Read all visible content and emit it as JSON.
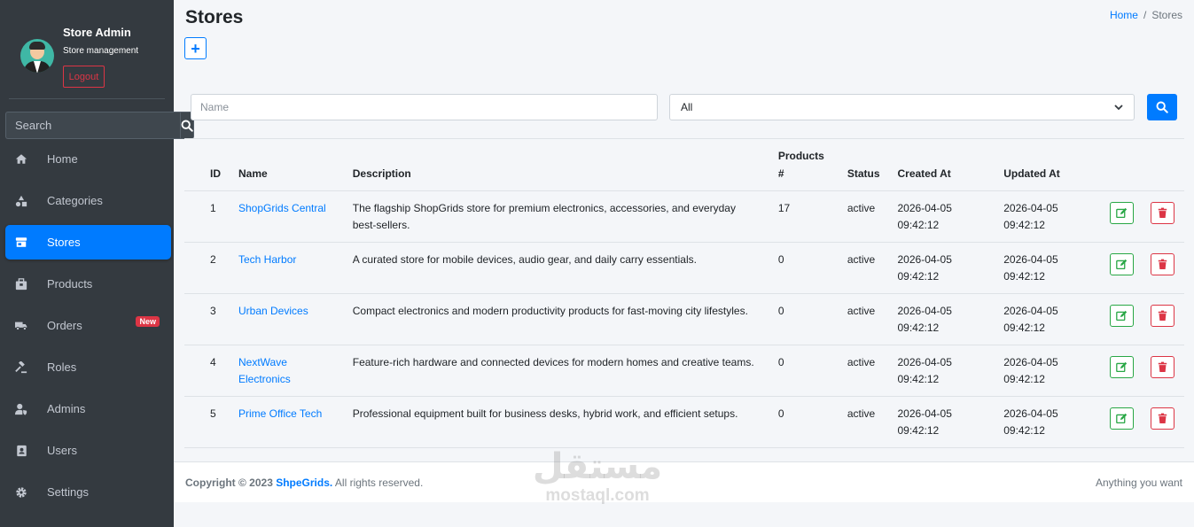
{
  "sidebar": {
    "user_name": "Store Admin",
    "user_role": "Store management",
    "logout_label": "Logout",
    "search_placeholder": "Search",
    "nav": [
      {
        "label": "Home",
        "icon": "home-icon"
      },
      {
        "label": "Categories",
        "icon": "shapes-icon"
      },
      {
        "label": "Stores",
        "icon": "store-icon",
        "active": true
      },
      {
        "label": "Products",
        "icon": "box-icon"
      },
      {
        "label": "Orders",
        "icon": "truck-icon",
        "badge": "New"
      },
      {
        "label": "Roles",
        "icon": "gavel-icon"
      },
      {
        "label": "Admins",
        "icon": "user-shield-icon"
      },
      {
        "label": "Users",
        "icon": "id-card-icon"
      },
      {
        "label": "Settings",
        "icon": "gear-icon"
      }
    ]
  },
  "header": {
    "title": "Stores",
    "breadcrumb_home": "Home",
    "breadcrumb_sep": "/",
    "breadcrumb_current": "Stores",
    "add_label": "+"
  },
  "filters": {
    "name_placeholder": "Name",
    "status_selected": "All"
  },
  "table": {
    "headers": {
      "id": "ID",
      "name": "Name",
      "description": "Description",
      "products_line1": "Products",
      "products_line2": "#",
      "status": "Status",
      "created": "Created At",
      "updated": "Updated At"
    },
    "rows": [
      {
        "id": "1",
        "name": "ShopGrids Central",
        "description": "The flagship ShopGrids store for premium electronics, accessories, and everyday best-sellers.",
        "products": "17",
        "status": "active",
        "created_date": "2026-04-05",
        "created_time": "09:42:12",
        "updated_date": "2026-04-05",
        "updated_time": "09:42:12"
      },
      {
        "id": "2",
        "name": "Tech Harbor",
        "description": "A curated store for mobile devices, audio gear, and daily carry essentials.",
        "products": "0",
        "status": "active",
        "created_date": "2026-04-05",
        "created_time": "09:42:12",
        "updated_date": "2026-04-05",
        "updated_time": "09:42:12"
      },
      {
        "id": "3",
        "name": "Urban Devices",
        "description": "Compact electronics and modern productivity products for fast-moving city lifestyles.",
        "products": "0",
        "status": "active",
        "created_date": "2026-04-05",
        "created_time": "09:42:12",
        "updated_date": "2026-04-05",
        "updated_time": "09:42:12"
      },
      {
        "id": "4",
        "name": "NextWave Electronics",
        "description": "Feature-rich hardware and connected devices for modern homes and creative teams.",
        "products": "0",
        "status": "active",
        "created_date": "2026-04-05",
        "created_time": "09:42:12",
        "updated_date": "2026-04-05",
        "updated_time": "09:42:12"
      },
      {
        "id": "5",
        "name": "Prime Office Tech",
        "description": "Professional equipment built for business desks, hybrid work, and efficient setups.",
        "products": "0",
        "status": "active",
        "created_date": "2026-04-05",
        "created_time": "09:42:12",
        "updated_date": "2026-04-05",
        "updated_time": "09:42:12"
      }
    ]
  },
  "footer": {
    "copyright": "Copyright © 2023",
    "brand": "ShpeGrids.",
    "rights": "All rights reserved.",
    "tagline": "Anything you want"
  },
  "watermark": {
    "arabic": "مستقل",
    "latin": "mostaql.com"
  },
  "colors": {
    "sidebar_bg": "#343a40",
    "primary": "#007bff",
    "success": "#28a745",
    "danger": "#dc3545",
    "content_bg": "#f4f6f9"
  }
}
